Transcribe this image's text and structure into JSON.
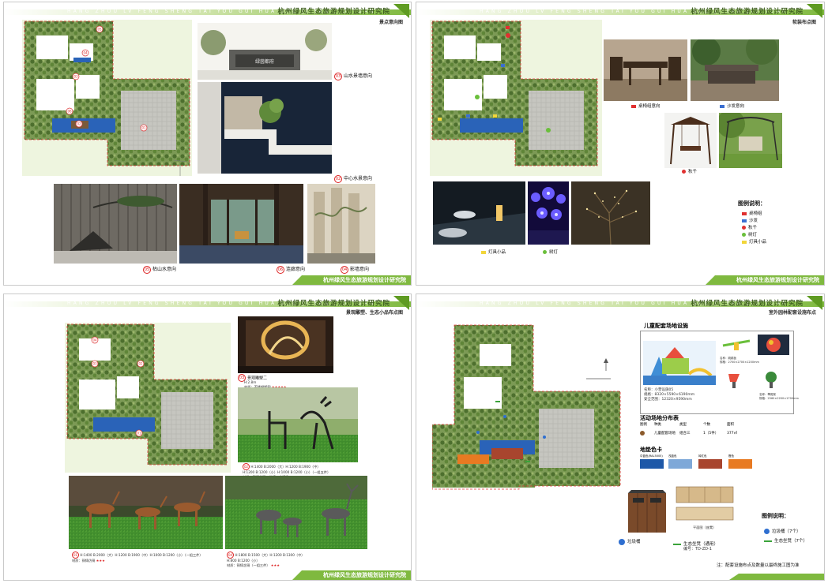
{
  "header": {
    "pinyin": "HANG ZHOU LV FENG SHENG TAI YOU GUI HUA SHE JI YAN JIU YUAN",
    "institute": "杭州绿风生态旅游规划设计研究院"
  },
  "footer": {
    "text": "杭州绿风生态旅游规划设计研究院"
  },
  "page1": {
    "title": "景点意向图",
    "captions": [
      {
        "no": "03",
        "text": "山水景墙意向"
      },
      {
        "no": "02",
        "text": "中心水景意向"
      },
      {
        "no": "05",
        "text": "枯山水意向"
      },
      {
        "no": "06",
        "text": "连廊意向"
      },
      {
        "no": "04",
        "text": "影墙意向"
      }
    ],
    "photo_sign": "绿茵都府",
    "map_markers": [
      "05",
      "04",
      "03",
      "06",
      "02",
      "01"
    ]
  },
  "page2": {
    "title": "软装布点图",
    "captions": [
      {
        "label": "桌椅组意向",
        "color": "#e03030"
      },
      {
        "label": "沙发意向",
        "color": "#3b6fd1"
      },
      {
        "label": "秋千",
        "color": "#e03030"
      },
      {
        "label": "灯具小品",
        "color": "#f2d63a"
      },
      {
        "label": "树灯",
        "color": "#6abf3b"
      }
    ],
    "legend_title": "图例说明：",
    "legend": [
      {
        "label": "桌椅组",
        "shape": "square",
        "color": "#e03030"
      },
      {
        "label": "沙发",
        "shape": "square",
        "color": "#3b6fd1"
      },
      {
        "label": "秋千",
        "shape": "circle",
        "color": "#e03030"
      },
      {
        "label": "树灯",
        "shape": "circle",
        "color": "#6abf3b"
      },
      {
        "label": "灯具小品",
        "shape": "square",
        "color": "#f2d63a"
      }
    ]
  },
  "page3": {
    "title": "景观雕塑、生态小品布点图",
    "sculpture_caption": "景观雕塑二",
    "sculpture_specs": [
      "H:2.8m",
      "材质：不锈钢镀铜"
    ],
    "deer_caption_1": [
      "H:1400 B:2000（大）H:1200 B:1900（中）",
      "H:1200 B:1200（小）H:1000 B:1200（小）（一组五件）",
      "材质：铜铸仿铜、铁铸、金铸色"
    ],
    "deer_caption_2": [
      "H:1400 B:2000（大）H:1200 B:1900（中）H:1000 B:1200（小）（一组三件）",
      "材质：铜铸仿铜"
    ],
    "deer_caption_3": [
      "H:1800 B:1500（大）H:1200 B:1300（中）",
      "H:800 B:1200（小）",
      "材质：铜铸含铜（一组三件）"
    ],
    "map_markers": [
      "04",
      "03",
      "02",
      "01"
    ]
  },
  "page4": {
    "title": "室外园林配套设施布点",
    "kids_title": "儿童配套场地设施",
    "kids_specs": [
      "名称：小营设施05",
      "规格：8320×5590×6190mm",
      "安全范围：12320×9590mm"
    ],
    "kids_small_specs": [
      "名称：跷跷板",
      "规格：2700×2700×1200mm",
      "名称：攀爬架",
      "规格：2560×2200×1700mm"
    ],
    "activity_title": "活动场地分布表",
    "activity_headers": [
      "图例",
      "种类",
      "类型",
      "个数",
      "面积"
    ],
    "activity_row": [
      "儿童配套场地",
      "组合三",
      "1（5件）",
      "377㎡"
    ],
    "color_card_title": "地垫色卡",
    "color_swatches": [
      {
        "label": "中蓝色(RAL5005)",
        "color": "#1d58a8"
      },
      {
        "label": "浅蓝色",
        "color": "#7ea8d8"
      },
      {
        "label": "砖红色",
        "color": "#a8452e"
      },
      {
        "label": "橙色",
        "color": "#e87a22"
      }
    ],
    "trash_label": "垃圾桶",
    "bench_label": "生态坐凳（通用）",
    "bench_code": "编号：TD-ZD-1",
    "bench_plan_label": "平面图（座凳）",
    "legend_title": "图例说明：",
    "legend": [
      {
        "label": "垃圾桶（7个）",
        "color": "#2f6fd0",
        "shape": "circle"
      },
      {
        "label": "生态坐凳（7个）",
        "color": "#3aa33a",
        "shape": "bar"
      }
    ],
    "note": "注：配套设施布点及数量以最终施工图为准"
  }
}
